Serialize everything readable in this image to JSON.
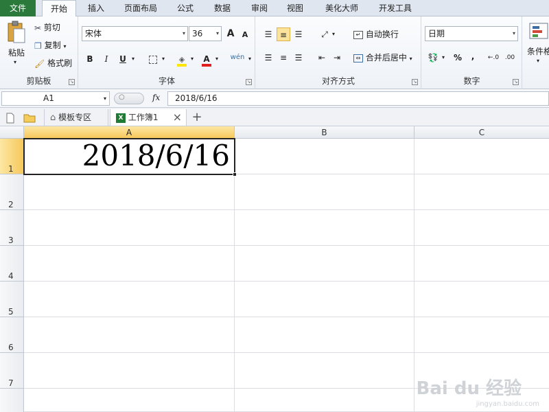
{
  "tabs": [
    {
      "label": "文件"
    },
    {
      "label": "开始"
    },
    {
      "label": "插入"
    },
    {
      "label": "页面布局"
    },
    {
      "label": "公式"
    },
    {
      "label": "数据"
    },
    {
      "label": "审阅"
    },
    {
      "label": "视图"
    },
    {
      "label": "美化大师"
    },
    {
      "label": "开发工具"
    }
  ],
  "clipboard": {
    "paste": "粘贴",
    "cut": "剪切",
    "copy": "复制",
    "format_painter": "格式刷",
    "group": "剪贴板"
  },
  "font": {
    "name": "宋体",
    "size": "36",
    "group": "字体",
    "bold": "B",
    "italic": "I",
    "underline": "U",
    "grow": "A",
    "shrink": "A",
    "pinyin": "wén"
  },
  "alignment": {
    "wrap": "自动换行",
    "merge": "合并后居中",
    "group": "对齐方式"
  },
  "number": {
    "format": "日期",
    "group": "数字",
    "percent": "%",
    "comma": ","
  },
  "styles": {
    "conditional": "条件格"
  },
  "formula_bar": {
    "cell_ref": "A1",
    "fx": "fx",
    "value": "2018/6/16"
  },
  "doc_tabs": {
    "template": "模板专区",
    "workbook": "工作簿1",
    "close": "×",
    "add": "+"
  },
  "grid": {
    "columns": [
      "A",
      "B",
      "C"
    ],
    "rows": [
      "1",
      "2",
      "3",
      "4",
      "5",
      "6",
      "7"
    ],
    "a1_value": "2018/6/16"
  },
  "watermark": {
    "brand": "Bai du 经验",
    "url": "jingyan.baidu.com"
  },
  "colors": {
    "file_tab": "#2b7a3c",
    "selection_header": "#f6c85c"
  }
}
